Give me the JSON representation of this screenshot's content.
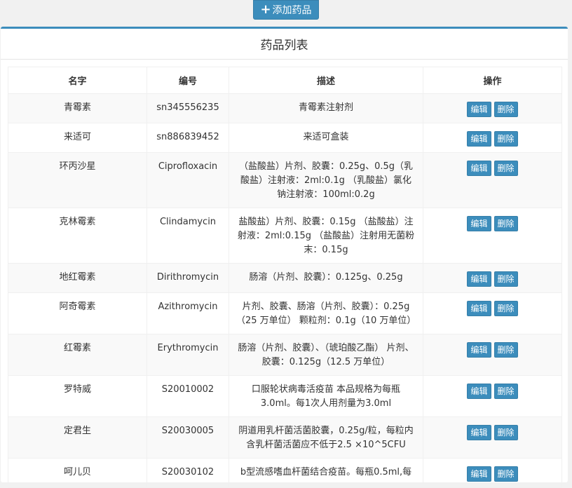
{
  "toolbar": {
    "add_label": "添加药品"
  },
  "panel": {
    "title": "药品列表"
  },
  "table": {
    "headers": [
      "名字",
      "编号",
      "描述",
      "操作"
    ],
    "edit_label": "编辑",
    "delete_label": "删除",
    "rows": [
      {
        "name": "青霉素",
        "code": "sn345556235",
        "desc": "青霉素注射剂"
      },
      {
        "name": "来适可",
        "code": "sn886839452",
        "desc": "来适可盒装"
      },
      {
        "name": "环丙沙星",
        "code": "Ciprofloxacin",
        "desc": "（盐酸盐）片剂、胶囊：0.25g、0.5g（乳酸盐）注射液：2ml:0.1g （乳酸盐）氯化钠注射液：100ml:0.2g"
      },
      {
        "name": "克林霉素",
        "code": "Clindamycin",
        "desc": "盐酸盐）片剂、胶囊：0.15g （盐酸盐）注射液：2ml:0.15g （盐酸盐）注射用无菌粉末：0.15g"
      },
      {
        "name": "地红霉素",
        "code": "Dirithromycin",
        "desc": "肠溶（片剂、胶囊）：0.125g、0.25g"
      },
      {
        "name": "阿奇霉素",
        "code": "Azithromycin",
        "desc": "片剂、胶囊、肠溶（片剂、胶囊）：0.25g（25 万单位） 颗粒剂：0.1g（10 万单位）"
      },
      {
        "name": "红霉素",
        "code": "Erythromycin",
        "desc": "肠溶（片剂、胶囊）、（琥珀酸乙酯） 片剂、胶囊：0.125g（12.5 万单位）"
      },
      {
        "name": "罗特威",
        "code": "S20010002",
        "desc": "口服轮状病毒活疫苗 本品规格为每瓶3.0ml。每1次人用剂量为3.0ml"
      },
      {
        "name": "定君生",
        "code": "S20030005",
        "desc": "阴道用乳杆菌活菌胶囊，0.25g/粒，每粒内含乳杆菌活菌应不低于2.5 ×10^5CFU"
      },
      {
        "name": "呵儿贝",
        "code": "S20030102",
        "desc": "b型流感嗜血杆菌结合疫苗。每瓶0.5ml,每"
      }
    ]
  }
}
